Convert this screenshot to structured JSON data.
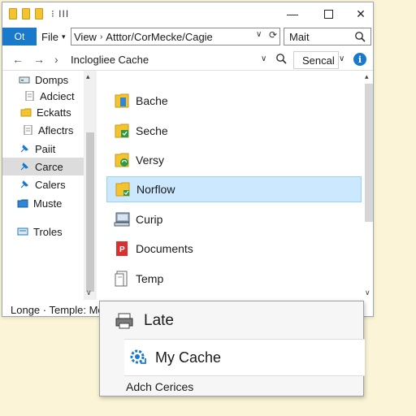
{
  "titlebar": {
    "glyph": "⁝ III",
    "min_label": "—",
    "close_label": "✕"
  },
  "ribbon": {
    "blue_tab": "Ot",
    "file_menu": "File",
    "address": {
      "part1": "View",
      "sep": "›",
      "part2": "Atttor/CorMecke/Cagie"
    },
    "search_placeholder": "Mait"
  },
  "navbar": {
    "back": "←",
    "forward": "→",
    "up": "›",
    "path": "Inclogliee Cache",
    "search_box": "Sencal",
    "info": "i"
  },
  "sidebar": {
    "items": [
      {
        "label": "Domps",
        "icon": "drive-icon"
      },
      {
        "label": "Adciect",
        "icon": "document-icon"
      },
      {
        "label": "Eckatts",
        "icon": "folder-icon"
      },
      {
        "label": "Aflectrs",
        "icon": "document-icon"
      },
      {
        "label": "Paiit",
        "icon": "pin-icon"
      },
      {
        "label": "Carce",
        "icon": "pin-icon",
        "selected": true
      },
      {
        "label": "Calers",
        "icon": "pin-icon"
      },
      {
        "label": "Muste",
        "icon": "folder-blue-icon"
      },
      {
        "label": "Troles",
        "icon": "drive-icon"
      }
    ]
  },
  "files": [
    {
      "label": "Bache",
      "icon": "folder-blue-doc-icon"
    },
    {
      "label": "Seche",
      "icon": "folder-green-icon"
    },
    {
      "label": "Versy",
      "icon": "folder-sync-icon"
    },
    {
      "label": "Norflow",
      "icon": "folder-check-icon",
      "selected": true
    },
    {
      "label": "Curip",
      "icon": "computer-icon"
    },
    {
      "label": "Documents",
      "icon": "pdf-icon"
    },
    {
      "label": "Temp",
      "icon": "file-icon"
    }
  ],
  "statusbar": {
    "text": "Longe · Templе: Me"
  },
  "popup": {
    "items": [
      {
        "label": "Late",
        "icon": "printer-icon"
      },
      {
        "label": "My Cache",
        "icon": "gear-sync-icon"
      },
      {
        "label": "Adch Cerices"
      }
    ]
  },
  "colors": {
    "accent": "#1979ca",
    "selection": "#cce8ff",
    "folder": "#f4c430",
    "background": "#fbf4d6"
  }
}
